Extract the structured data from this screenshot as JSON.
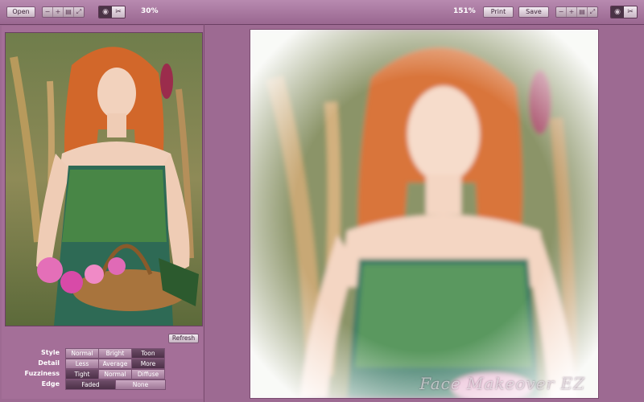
{
  "toolbar": {
    "open_label": "Open",
    "zoom_left": "30%",
    "zoom_right": "151%",
    "print_label": "Print",
    "save_label": "Save",
    "tool_icons": [
      "minus-icon",
      "plus-icon",
      "fit-icon",
      "expand-icon"
    ]
  },
  "controls": {
    "refresh_label": "Refresh",
    "style": {
      "label": "Style",
      "options": [
        "Normal",
        "Bright",
        "Toon"
      ],
      "selected": "Toon"
    },
    "detail": {
      "label": "Detail",
      "options": [
        "Less",
        "Average",
        "More"
      ],
      "selected": "More"
    },
    "fuzziness": {
      "label": "Fuzziness",
      "options": [
        "Tight",
        "Normal",
        "Diffuse"
      ],
      "selected": "Tight"
    },
    "edge": {
      "label": "Edge",
      "options": [
        "Faded",
        "None"
      ],
      "selected": "Faded"
    }
  },
  "watermark": "Face Makeover EZ",
  "colors": {
    "accent": "#9d6a92",
    "panel": "#a46f98",
    "selected": "#4c3048"
  }
}
